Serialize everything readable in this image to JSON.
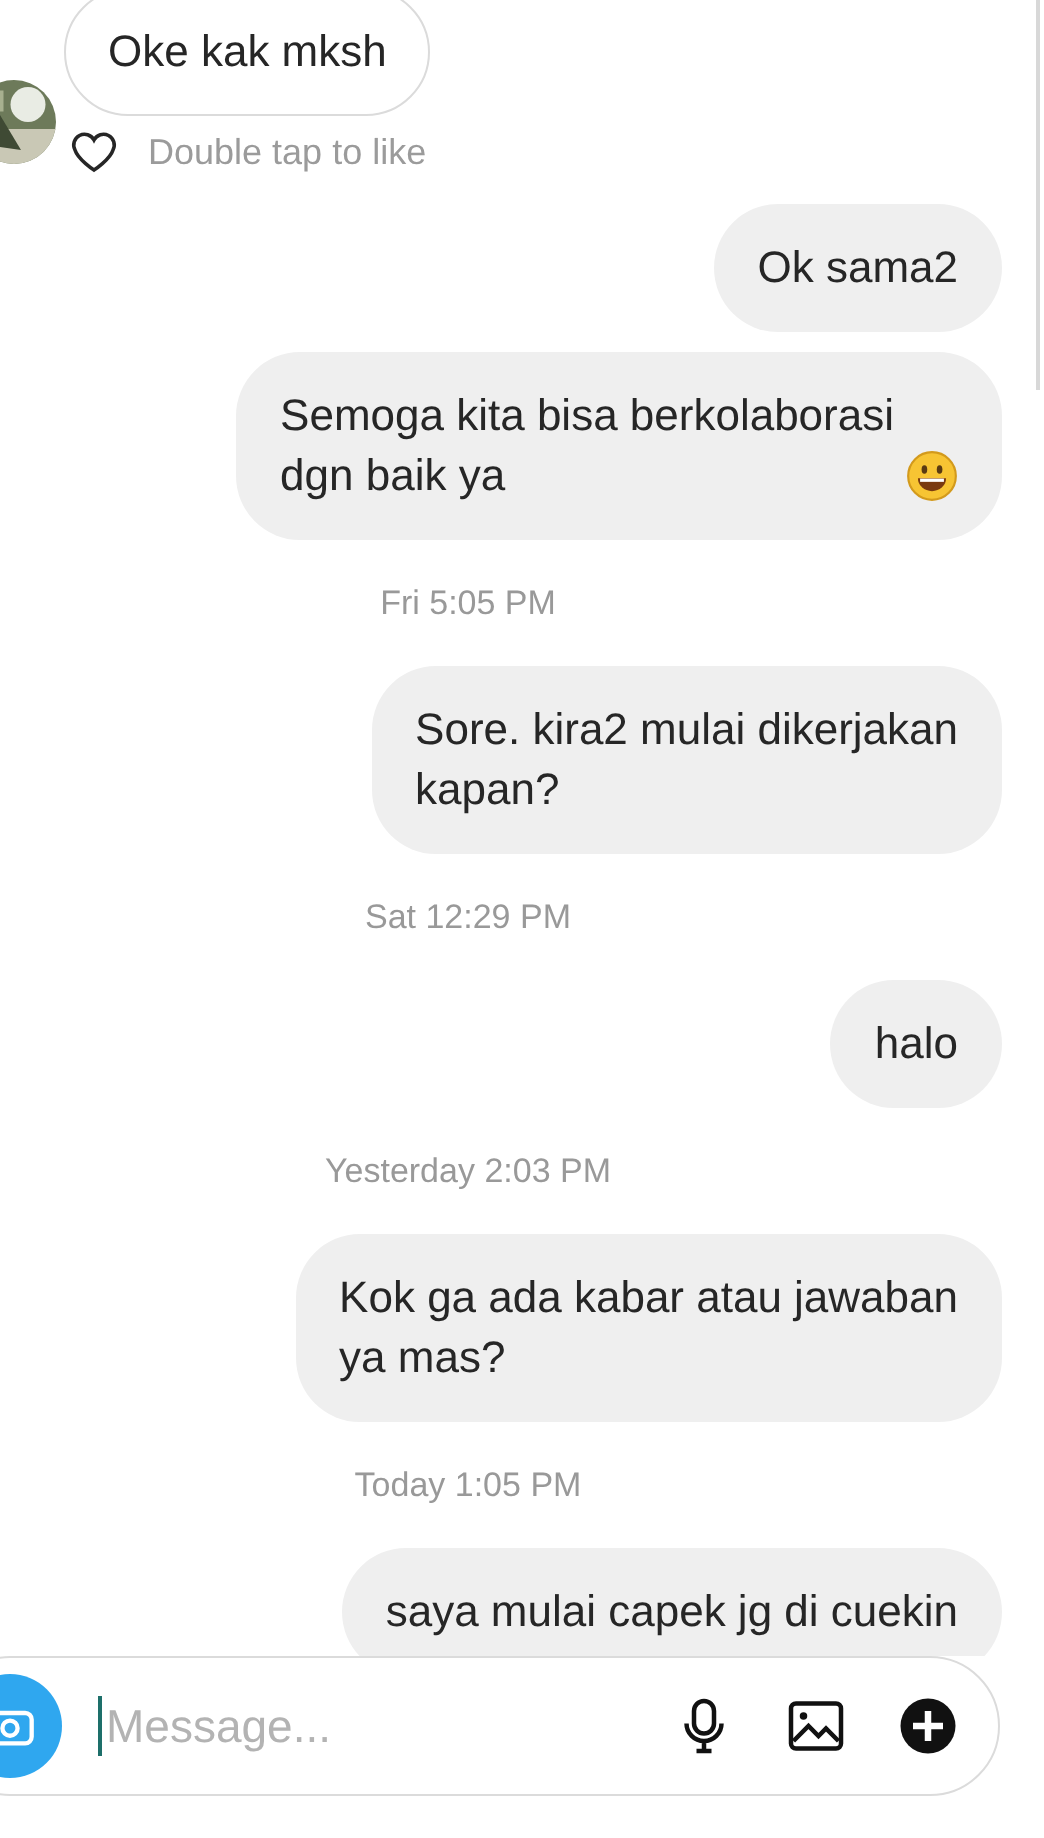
{
  "messages": [
    {
      "kind": "received",
      "text": "Oke kak mksh",
      "has_avatar": true,
      "like_hint": "Double tap to like"
    },
    {
      "kind": "sent",
      "text": "Ok sama2"
    },
    {
      "kind": "sent",
      "text": "Semoga kita bisa berkolaborasi\ndgn baik ya",
      "has_emoji": true
    },
    {
      "kind": "timestamp",
      "text": "Fri 5:05 PM"
    },
    {
      "kind": "sent",
      "text": "Sore. kira2 mulai dikerjakan\nkapan?"
    },
    {
      "kind": "timestamp",
      "text": "Sat 12:29 PM"
    },
    {
      "kind": "sent",
      "text": "halo"
    },
    {
      "kind": "timestamp",
      "text": "Yesterday 2:03 PM"
    },
    {
      "kind": "sent",
      "text": "Kok ga ada kabar atau jawaban\nya mas?"
    },
    {
      "kind": "timestamp",
      "text": "Today 1:05 PM"
    },
    {
      "kind": "sent",
      "text": "saya mulai capek jg di cuekin"
    }
  ],
  "composer": {
    "placeholder": "Message..."
  }
}
